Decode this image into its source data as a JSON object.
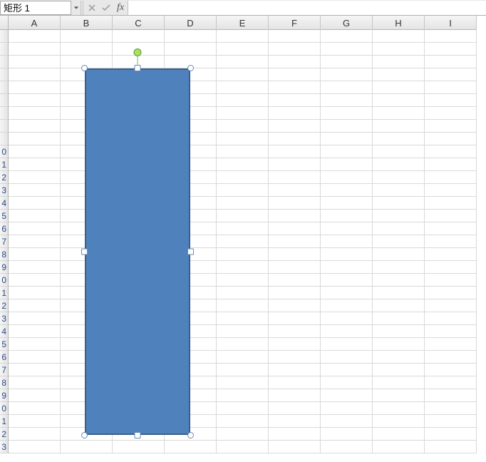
{
  "formula_bar": {
    "name_box_value": "矩形 1",
    "fx_label": "fx",
    "formula_value": ""
  },
  "columns": [
    "A",
    "B",
    "C",
    "D",
    "E",
    "F",
    "G",
    "H",
    "I"
  ],
  "rows_visible": [
    "",
    "",
    "",
    "",
    "",
    "",
    "",
    "",
    "",
    "0",
    "1",
    "2",
    "3",
    "4",
    "5",
    "6",
    "7",
    "8",
    "9",
    "0",
    "1",
    "2",
    "3",
    "4",
    "5",
    "6",
    "7",
    "8",
    "9",
    "0",
    "1",
    "2",
    "3"
  ],
  "shape": {
    "name": "矩形 1",
    "fill": "#4f81bd",
    "border": "#3a5f8a"
  }
}
